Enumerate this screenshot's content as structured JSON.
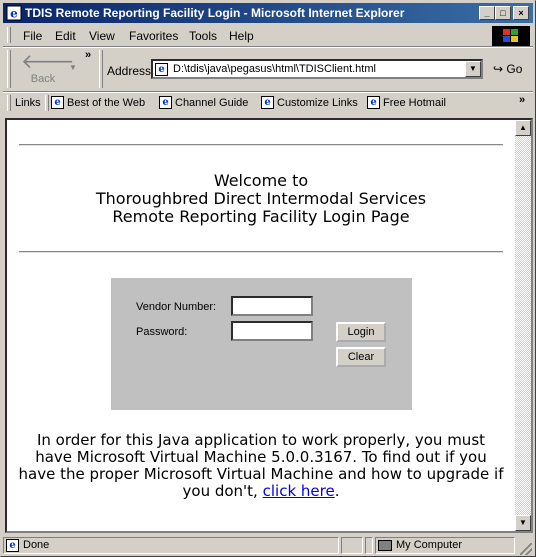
{
  "window": {
    "title": "TDIS Remote Reporting Facility Login - Microsoft Internet Explorer",
    "minimize_glyph": "_",
    "maximize_glyph": "□",
    "close_glyph": "×"
  },
  "menu": [
    "File",
    "Edit",
    "View",
    "Favorites",
    "Tools",
    "Help"
  ],
  "toolbar": {
    "back_label": "Back",
    "address_label": "Address",
    "url": "D:\\tdis\\java\\pegasus\\html\\TDISClient.html",
    "go_label": "Go",
    "more_glyph": "»"
  },
  "links_bar": {
    "label": "Links",
    "items": [
      "Best of the Web",
      "Channel Guide",
      "Customize Links",
      "Free Hotmail"
    ],
    "more_glyph": "»"
  },
  "page": {
    "welcome_line1": "Welcome to",
    "welcome_line2": "Thoroughbred Direct Intermodal Services",
    "welcome_line3": "Remote Reporting Facility Login Page",
    "vendor_label": "Vendor Number:",
    "vendor_value": "",
    "password_label": "Password:",
    "password_value": "",
    "login_button": "Login",
    "clear_button": "Clear",
    "notice_text": "In order for this Java application to work properly, you must have Microsoft Virtual Machine 5.0.0.3167. To find out if you have the proper Microsoft Virtual Machine and how to upgrade if you don't,",
    "notice_link": "click here",
    "notice_end": "."
  },
  "status": {
    "text": "Done",
    "zone": "My Computer"
  },
  "colors": {
    "titlebar": "#0a246a",
    "chrome": "#d4d0c8",
    "login_panel": "#c0c0c0",
    "link": "#0000ee"
  }
}
